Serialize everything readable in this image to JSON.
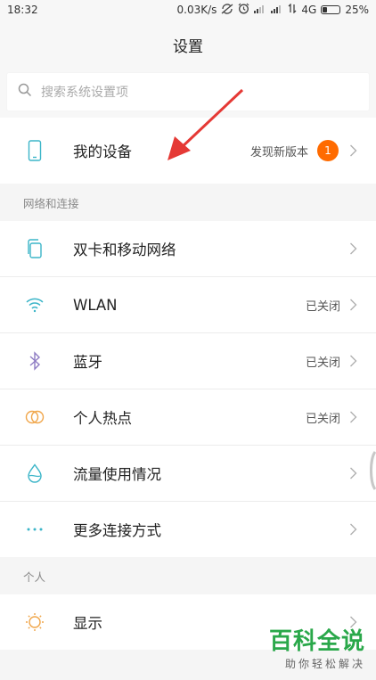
{
  "status_bar": {
    "time": "18:32",
    "speed": "0.03K/s",
    "network": "4G",
    "battery": "25%"
  },
  "title": "设置",
  "search": {
    "placeholder": "搜索系统设置项"
  },
  "device": {
    "label": "我的设备",
    "value": "发现新版本",
    "badge": "1"
  },
  "section_network": {
    "header": "网络和连接",
    "items": [
      {
        "label": "双卡和移动网络",
        "value": ""
      },
      {
        "label": "WLAN",
        "value": "已关闭"
      },
      {
        "label": "蓝牙",
        "value": "已关闭"
      },
      {
        "label": "个人热点",
        "value": "已关闭"
      },
      {
        "label": "流量使用情况",
        "value": ""
      },
      {
        "label": "更多连接方式",
        "value": ""
      }
    ]
  },
  "section_personal": {
    "header": "个人",
    "items": [
      {
        "label": "显示",
        "value": ""
      }
    ]
  },
  "watermark": {
    "main": "百科全说",
    "sub": "助你轻松解决"
  },
  "colors": {
    "accent": "#3bb5c8",
    "badge": "#ff6b00",
    "bluetooth": "#8e7cc3",
    "hotspot": "#f0a64a",
    "display": "#f0a64a",
    "arrow": "#e53935",
    "watermark": "#2aa84a"
  }
}
